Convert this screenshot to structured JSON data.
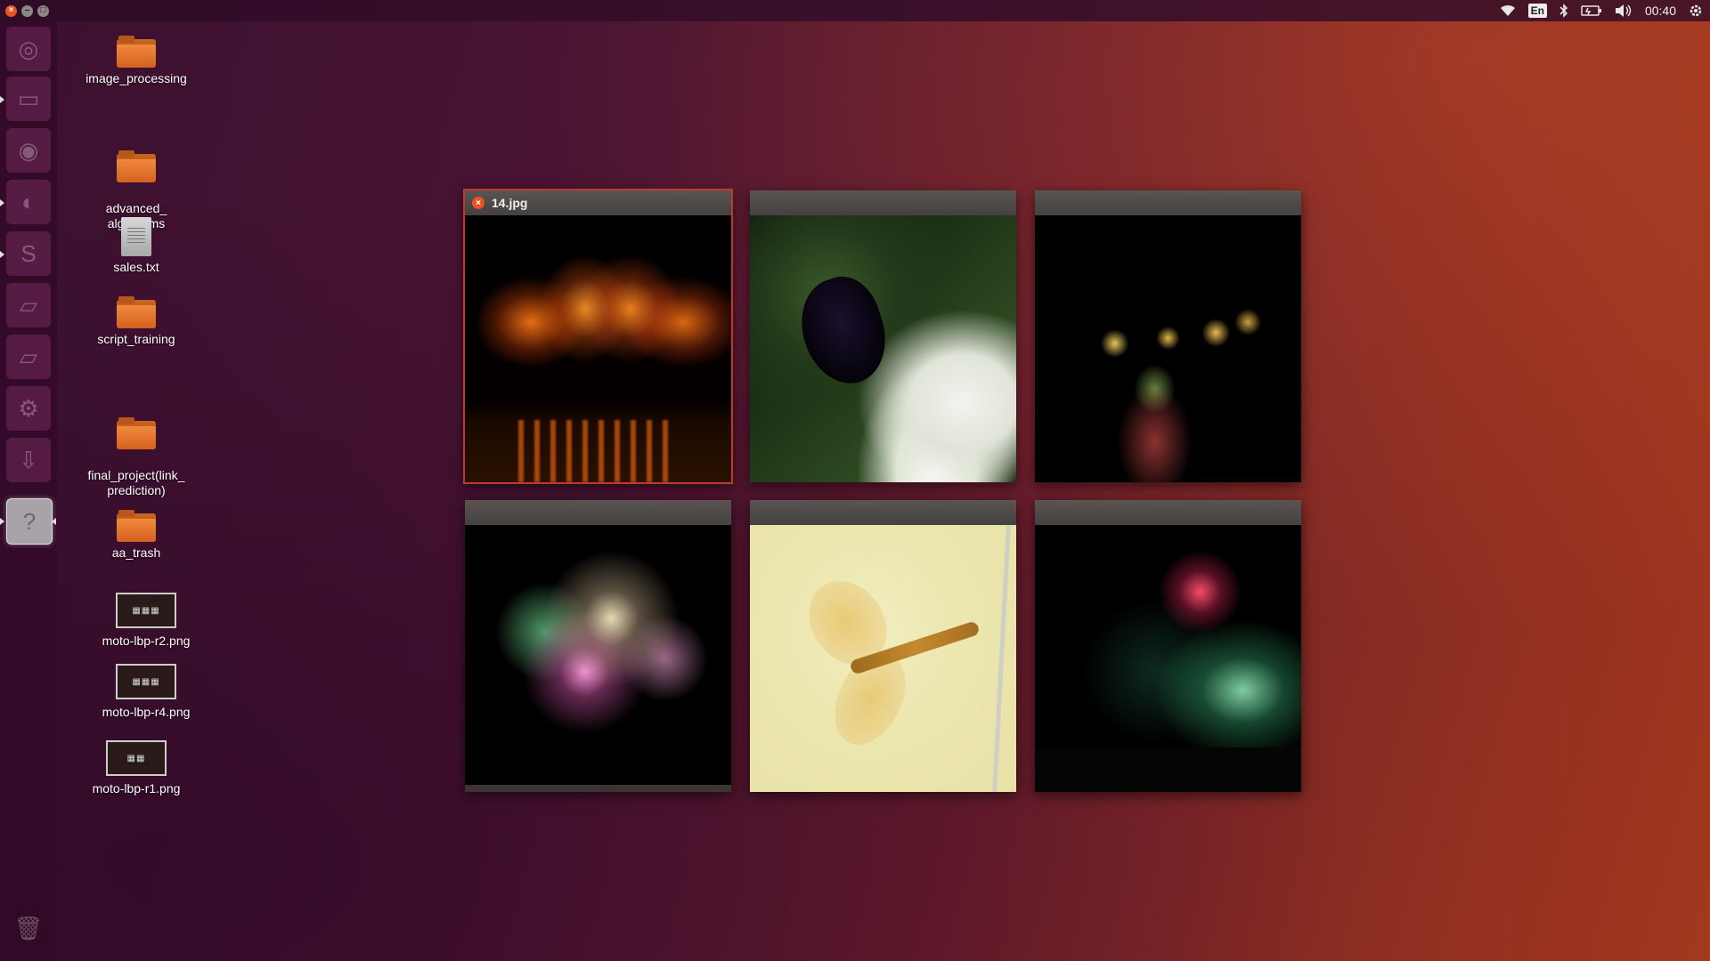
{
  "top_panel": {
    "window_controls": {
      "close_glyph": "×",
      "minimize_glyph": "–",
      "maximize_glyph": "□"
    },
    "keyboard_layout": "En",
    "clock": "00:40",
    "indicator_icons": [
      "wifi-icon",
      "keyboard-layout-icon",
      "bluetooth-icon",
      "battery-icon",
      "volume-icon",
      "clock",
      "session-gear-icon"
    ]
  },
  "launcher": {
    "items": [
      {
        "name": "dash-home",
        "icon": "ubuntu-logo-icon",
        "glyph": "◎",
        "active": false
      },
      {
        "name": "files",
        "icon": "files-icon",
        "glyph": "▭",
        "active": false
      },
      {
        "name": "chromium",
        "icon": "chromium-icon",
        "glyph": "◉",
        "active": false
      },
      {
        "name": "firefox",
        "icon": "firefox-icon",
        "glyph": "◐",
        "active": false
      },
      {
        "name": "sublime",
        "icon": "sublime-text-icon",
        "glyph": "S",
        "active": false
      },
      {
        "name": "drive",
        "icon": "drive-icon",
        "glyph": "▱",
        "active": false
      },
      {
        "name": "drive-2",
        "icon": "drive-icon",
        "glyph": "▱",
        "active": false
      },
      {
        "name": "settings",
        "icon": "settings-gear-icon",
        "glyph": "⚙",
        "active": false
      },
      {
        "name": "software-updater",
        "icon": "download-arrow-icon",
        "glyph": "⇩",
        "active": false
      },
      {
        "name": "image-viewer",
        "icon": "help-question-icon",
        "glyph": "?",
        "active": true
      },
      {
        "name": "trash",
        "icon": "trash-icon",
        "glyph": "🗑",
        "active": false
      }
    ]
  },
  "desktop_icons": [
    {
      "label": "image_processing",
      "type": "folder"
    },
    {
      "label": "advanced_\nalgorithms",
      "type": "folder"
    },
    {
      "label": "sales.txt",
      "type": "text-file"
    },
    {
      "label": "script_training",
      "type": "folder"
    },
    {
      "label": "final_project(link_\nprediction)",
      "type": "folder"
    },
    {
      "label": "aa_trash",
      "type": "folder"
    },
    {
      "label": "moto-lbp-r2.png",
      "type": "image"
    },
    {
      "label": "moto-lbp-r4.png",
      "type": "image"
    },
    {
      "label": "moto-lbp-r1.png",
      "type": "image"
    }
  ],
  "spread_windows": [
    {
      "title": "14.jpg",
      "selected": true,
      "image": "fireworks-orange"
    },
    {
      "title": "",
      "selected": false,
      "image": "butterfly"
    },
    {
      "title": "",
      "selected": false,
      "image": "fireworks-gold"
    },
    {
      "title": "",
      "selected": false,
      "image": "fireworks-pink"
    },
    {
      "title": "",
      "selected": false,
      "image": "dragonfly"
    },
    {
      "title": "",
      "selected": false,
      "image": "fireworks-red-green"
    }
  ],
  "colors": {
    "accent": "#e95420",
    "panel": "#3a0f2b",
    "launcher": "#320a28"
  }
}
